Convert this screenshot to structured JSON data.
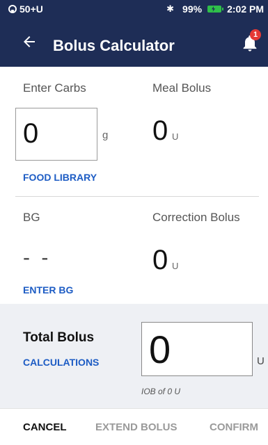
{
  "status_bar": {
    "pod_label": "50+U",
    "battery_percent": "99%",
    "time": "2:02 PM"
  },
  "app_bar": {
    "title": "Bolus Calculator",
    "notification_count": "1"
  },
  "carbs": {
    "label": "Enter Carbs",
    "value": "0",
    "unit": "g",
    "link": "FOOD LIBRARY"
  },
  "meal_bolus": {
    "label": "Meal Bolus",
    "value": "0",
    "unit": "U"
  },
  "bg": {
    "label": "BG",
    "value": "- -",
    "link": "ENTER BG"
  },
  "correction_bolus": {
    "label": "Correction Bolus",
    "value": "0",
    "unit": "U"
  },
  "total": {
    "label": "Total Bolus",
    "link": "CALCULATIONS",
    "value": "0",
    "unit": "U",
    "iob": "IOB of 0 U"
  },
  "footer": {
    "cancel": "CANCEL",
    "extend": "EXTEND BOLUS",
    "confirm": "CONFIRM"
  },
  "colors": {
    "header": "#1e2d56",
    "link": "#1d5cc4",
    "badge": "#e53935",
    "battery": "#2fbf4a",
    "disabled": "#9a9a9a"
  }
}
